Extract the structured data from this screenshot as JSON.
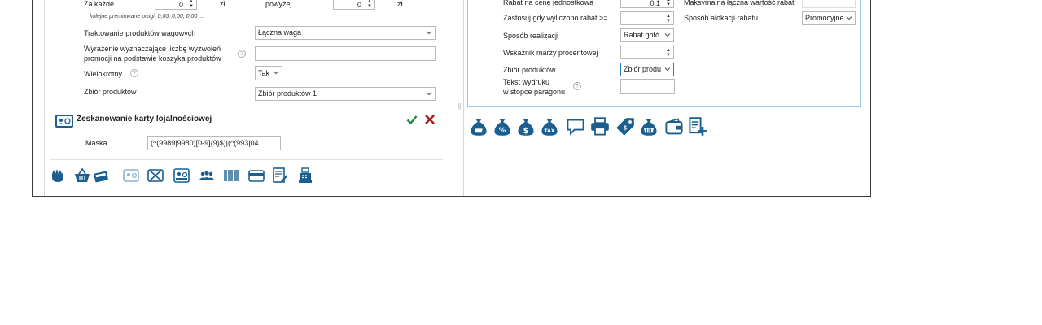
{
  "left_panel": {
    "za_kazde_label": "Za każde",
    "za_kazde_value": "0",
    "za_kazde_unit": "zł",
    "powyzej_label": "powyżej",
    "powyzej_value": "0",
    "powyzej_unit": "zł",
    "kolejne_progi": "kolejne premiowane progi: 0,00, 0,00, 0,00 ...",
    "wagowe_label": "Traktowanie produktów wagowych",
    "wagowe_value": "Łączna waga",
    "wyrazenie_label_line1": "Wyrażenie wyznaczające liczbę wyzwoleń",
    "wyrazenie_label_line2": "promocji na podstawie koszyka produktów",
    "wyrazenie_value": "",
    "wielokrotny_label": "Wielokrotny",
    "wielokrotny_value": "Tak",
    "zbior_label": "Zbiór produktów",
    "zbior_value": "Zbiór produktów 1",
    "loyalty_title": "Zeskanowanie karty lojalnościowej",
    "maska_label": "Maska",
    "maska_value": "(^(9989|9980)[0-9]{9}$)|(^(993|04"
  },
  "right_panel": {
    "rabat_label": "Rabat na cenę jednostkową",
    "rabat_value": "0,1",
    "zastosuj_label": "Zastosuj gdy wyliczono rabat >=",
    "zastosuj_value": "",
    "sposob_label": "Sposób realizacji",
    "sposob_value": "Rabat gotó",
    "marza_label": "Wskaźnik marży procentowej",
    "marza_value": "",
    "zbior_label": "Zbiór produktów",
    "zbior_value": "Zbiór produ",
    "tekst_label_line1": "Tekst wydruku",
    "tekst_label_line2": "w stopce paragonu",
    "tekst_value": "",
    "max_label": "Maksymalna łączna wartość rabat",
    "max_value": "",
    "alokacja_label": "Sposób alokacji rabatu",
    "alokacja_value": "Promocyjne"
  },
  "icons": {
    "accent": "#1a5f8f"
  }
}
